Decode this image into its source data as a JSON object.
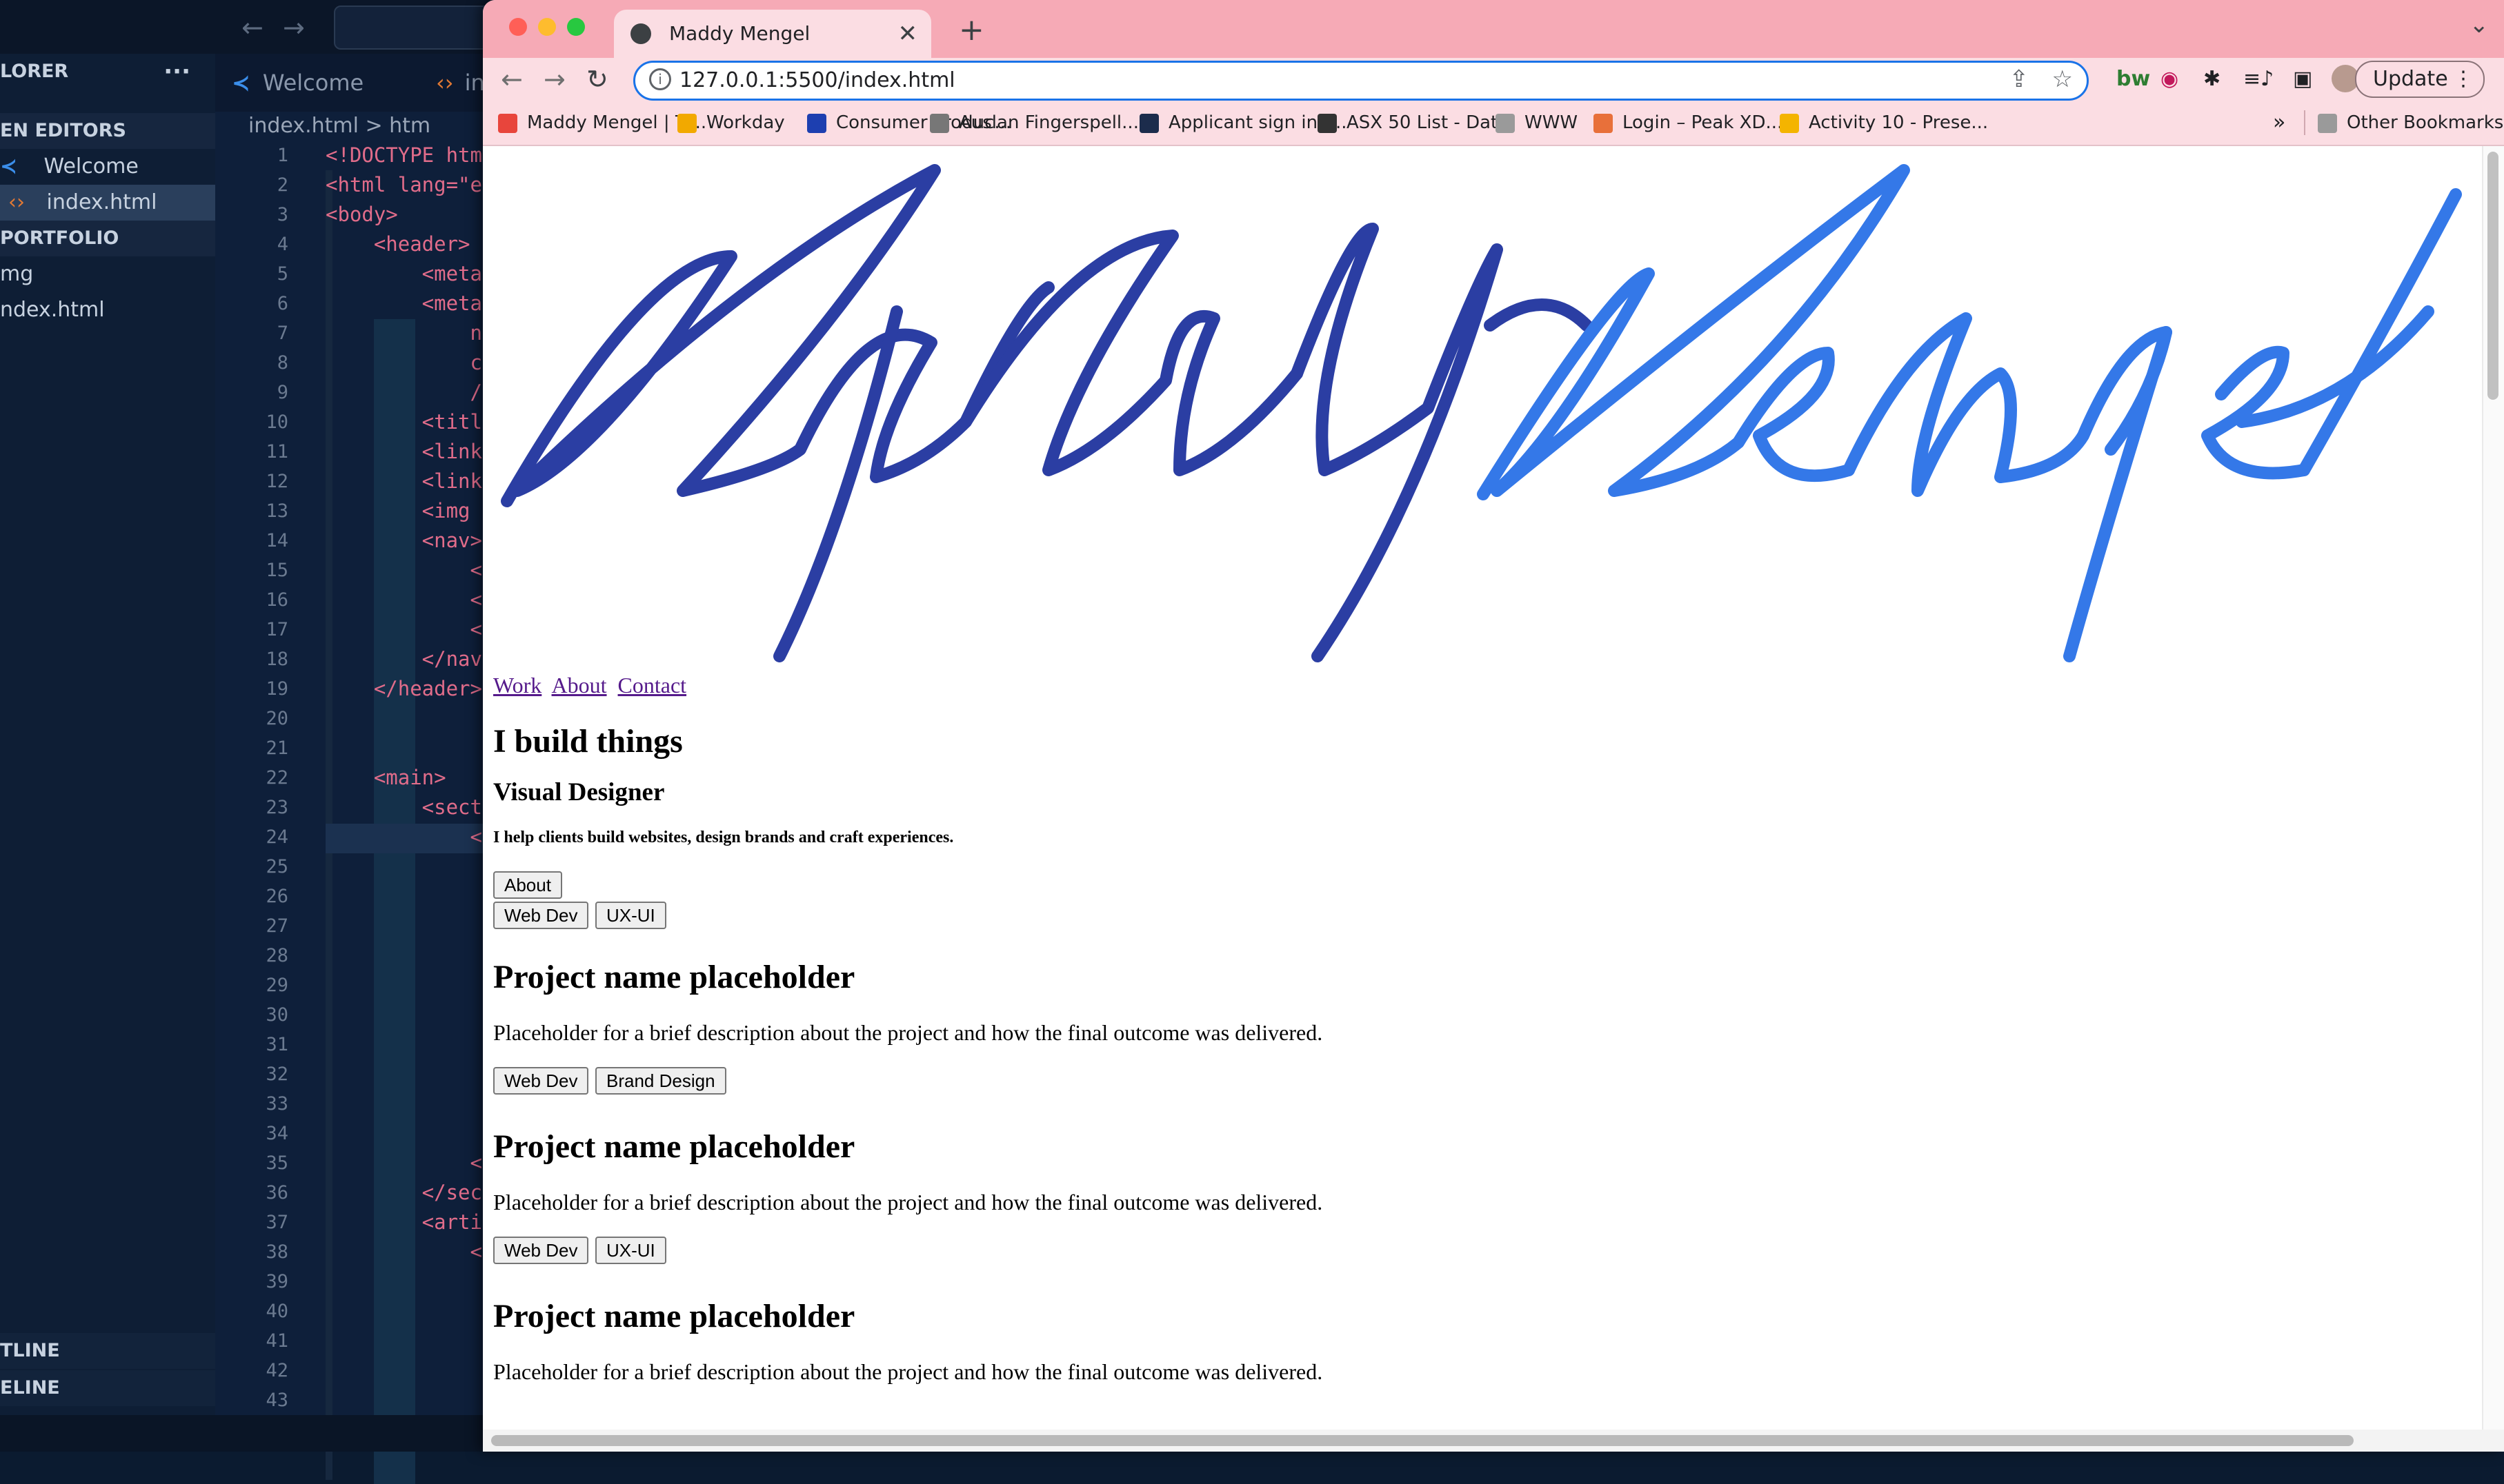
{
  "vscode": {
    "nav_back": "←",
    "nav_fwd": "→",
    "sidebar": {
      "explorer_label": "LORER",
      "more": "···",
      "open_editors_label": "EN EDITORS",
      "open_editors": [
        "Welcome",
        "index.html"
      ],
      "folder_label": "PORTFOLIO",
      "folder_items": [
        "mg",
        "ndex.html"
      ],
      "outline_label": "TLINE",
      "timeline_label": "ELINE"
    },
    "tabs": [
      "Welcome",
      "in"
    ],
    "breadcrumb": "index.html > htm",
    "line_numbers": [
      "1",
      "2",
      "3",
      "4",
      "5",
      "6",
      "7",
      "8",
      "9",
      "10",
      "11",
      "12",
      "13",
      "14",
      "15",
      "16",
      "17",
      "18",
      "19",
      "20",
      "21",
      "22",
      "23",
      "24",
      "25",
      "26",
      "27",
      "28",
      "29",
      "30",
      "31",
      "32",
      "33",
      "34",
      "35",
      "36",
      "37",
      "38",
      "39",
      "40",
      "41",
      "42",
      "43"
    ],
    "code_lines": [
      "<!DOCTYPE htm",
      "<html lang=\"e",
      "<body>",
      "    <header>",
      "        <meta",
      "        <meta",
      "            n",
      "            c",
      "            /",
      "        <titl",
      "        <link",
      "        <link",
      "        <img",
      "        <nav>",
      "            <",
      "            <",
      "            <",
      "        </nav",
      "    </header>",
      "",
      "",
      "    <main>",
      "        <sect",
      "            <",
      "",
      "",
      "",
      "",
      "",
      "",
      "",
      "",
      "",
      "",
      "            <",
      "        </sec",
      "        <arti",
      "            <",
      "",
      "",
      "",
      "",
      ""
    ]
  },
  "chrome": {
    "tab_title": "Maddy Mengel",
    "tab_close": "✕",
    "new_tab": "+",
    "tab_chevron": "⌄",
    "back": "←",
    "forward": "→",
    "reload": "↻",
    "info_icon": "i",
    "url": "127.0.0.1:5500/index.html",
    "share_icon": "⇪",
    "star_icon": "☆",
    "extensions": [
      "bw",
      "◉",
      "✱",
      "≡♪",
      "▣"
    ],
    "update_label": "Update",
    "update_menu": "⋮",
    "bookmarks": [
      {
        "label": "Maddy Mengel | Tr...",
        "color": "#e8453c"
      },
      {
        "label": "Workday",
        "color": "#f2a900"
      },
      {
        "label": "Consumer Produc...",
        "color": "#1d3fb0"
      },
      {
        "label": "Auslan Fingerspell...",
        "color": "#777777"
      },
      {
        "label": "Applicant sign in -...",
        "color": "#1c2c4c"
      },
      {
        "label": "ASX 50 List - Dat...",
        "color": "#333333"
      },
      {
        "label": "WWW",
        "color": "#9a9a9a"
      },
      {
        "label": "Login – Peak XD...",
        "color": "#e8703a"
      },
      {
        "label": "Activity 10 - Prese...",
        "color": "#f4b400"
      }
    ],
    "bookmarks_more": "»",
    "other_bookmarks": "Other Bookmarks"
  },
  "page": {
    "logo": {
      "first": "Maddy",
      "last": "Mengel",
      "first_color": "#2b3ea3",
      "last_color": "#3478e8"
    },
    "nav": [
      "Work",
      "About",
      "Contact"
    ],
    "hero_title": "I build things",
    "hero_role": "Visual Designer",
    "hero_tagline": "I help clients build websites, design brands and craft experiences.",
    "about_button": "About",
    "filter_buttons": [
      "Web Dev",
      "UX-UI"
    ],
    "projects": [
      {
        "title": "Project name placeholder",
        "desc": "Placeholder for a brief description about the project and how the final outcome was delivered.",
        "tags": [
          "Web Dev",
          "Brand Design"
        ]
      },
      {
        "title": "Project name placeholder",
        "desc": "Placeholder for a brief description about the project and how the final outcome was delivered.",
        "tags": [
          "Web Dev",
          "UX-UI"
        ]
      },
      {
        "title": "Project name placeholder",
        "desc": "Placeholder for a brief description about the project and how the final outcome was delivered.",
        "tags": []
      }
    ]
  }
}
